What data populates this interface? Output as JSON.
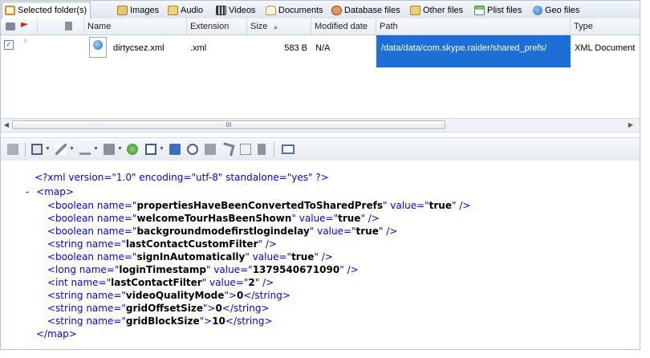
{
  "tabs": [
    {
      "label": "Selected folder(s)",
      "icon": "folder-checklist-icon",
      "color": "#d98c24"
    },
    {
      "label": "Images",
      "icon": "images-icon",
      "color": "#d9b243"
    },
    {
      "label": "Audio",
      "icon": "audio-icon",
      "color": "#e1b64a"
    },
    {
      "label": "Videos",
      "icon": "videos-icon",
      "color": "#4a4a4a"
    },
    {
      "label": "Documents",
      "icon": "documents-icon",
      "color": "#e6c16a"
    },
    {
      "label": "Database files",
      "icon": "database-icon",
      "color": "#cc6a2c"
    },
    {
      "label": "Other files",
      "icon": "folder-icon",
      "color": "#e3b84c"
    },
    {
      "label": "Plist files",
      "icon": "plist-icon",
      "color": "#58a84c"
    },
    {
      "label": "Geo files",
      "icon": "globe-icon",
      "color": "#2b74c0"
    }
  ],
  "grid": {
    "columns": [
      "Name",
      "Extension",
      "Size",
      "Modified date",
      "Path",
      "Type"
    ],
    "rows": [
      {
        "name": "dirtycsez.xml",
        "extension": ".xml",
        "size": "583 B",
        "modified": "N/A",
        "path": "/data/data/com.skype.raider/shared_prefs/",
        "type": "XML Document"
      }
    ]
  },
  "scroll_thumb_label": "III",
  "xml": {
    "decl": "<?xml version=\"1.0\" encoding=\"utf-8\" standalone=\"yes\" ?>",
    "collapse": "-",
    "root_open": "<map>",
    "root_close": "</map>",
    "entries": [
      {
        "open": "<boolean name=\"",
        "name": "propertiesHaveBeenConvertedToSharedPrefs",
        "mid": "\" value=\"",
        "value": "true",
        "close": "\" />"
      },
      {
        "open": "<boolean name=\"",
        "name": "welcomeTourHasBeenShown",
        "mid": "\" value=\"",
        "value": "true",
        "close": "\" />"
      },
      {
        "open": "<boolean name=\"",
        "name": "backgroundmodefirstlogindelay",
        "mid": "\" value=\"",
        "value": "true",
        "close": "\" />"
      },
      {
        "open": "<string name=\"",
        "name": "lastContactCustomFilter",
        "mid": "",
        "value": "",
        "close": "\" />"
      },
      {
        "open": "<boolean name=\"",
        "name": "signInAutomatically",
        "mid": "\" value=\"",
        "value": "true",
        "close": "\" />"
      },
      {
        "open": "<long name=\"",
        "name": "loginTimestamp",
        "mid": "\" value=\"",
        "value": "1379540671090",
        "close": "\" />"
      },
      {
        "open": "<int name=\"",
        "name": "lastContactFilter",
        "mid": "\" value=\"",
        "value": "2",
        "close": "\" />"
      },
      {
        "open": "<string name=\"",
        "name": "videoQualityMode",
        "mid": "\">",
        "value": "0",
        "close": "</string>"
      },
      {
        "open": "<string name=\"",
        "name": "gridOffsetSize",
        "mid": "\">",
        "value": "0",
        "close": "</string>"
      },
      {
        "open": "<string name=\"",
        "name": "gridBlockSize",
        "mid": "\">",
        "value": "10",
        "close": "</string>"
      }
    ]
  }
}
